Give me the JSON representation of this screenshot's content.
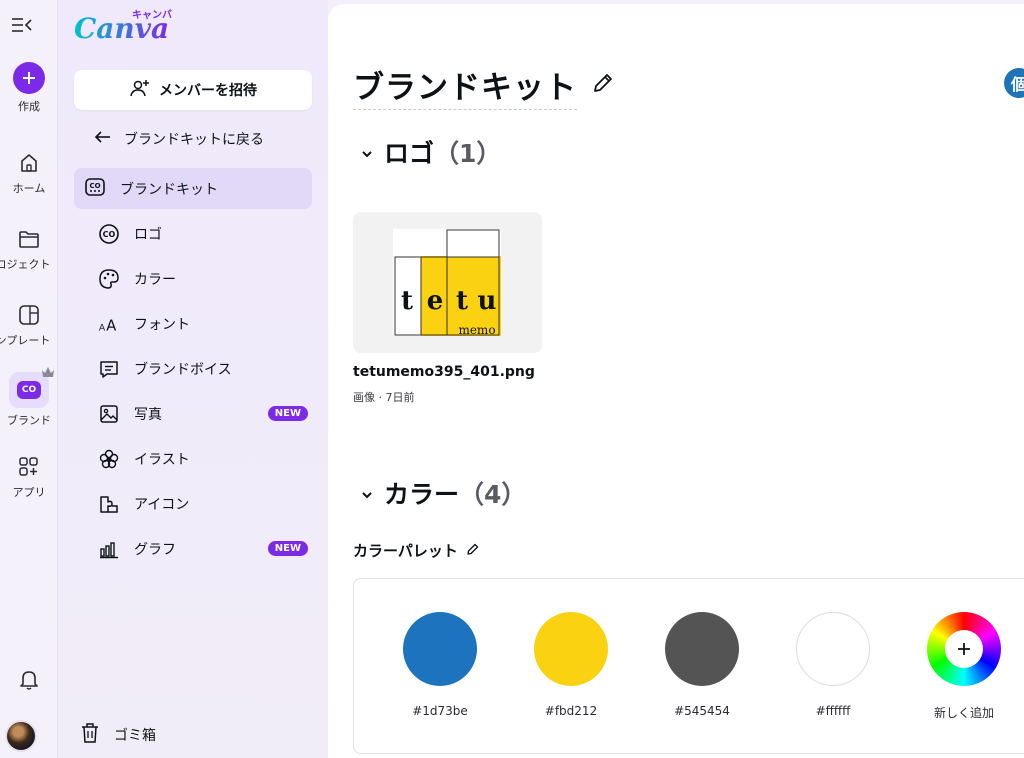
{
  "rail": {
    "create": "作成",
    "home": "ホーム",
    "projects": "ロジェクト",
    "templates": "ンプレート",
    "brand": "ブランド",
    "brand_chip": "CO",
    "apps": "アプリ"
  },
  "panel": {
    "logo_main": "Canva",
    "logo_sub": "キャンバ",
    "invite": "メンバーを招待",
    "back": "ブランドキットに戻る",
    "brand_kit": "ブランドキット",
    "items": [
      {
        "label": "ロゴ",
        "icon": "logo-co-icon"
      },
      {
        "label": "カラー",
        "icon": "palette-icon"
      },
      {
        "label": "フォント",
        "icon": "font-icon"
      },
      {
        "label": "ブランドボイス",
        "icon": "message-icon"
      },
      {
        "label": "写真",
        "icon": "image-icon",
        "badge": "NEW"
      },
      {
        "label": "イラスト",
        "icon": "flower-icon"
      },
      {
        "label": "アイコン",
        "icon": "shapes-icon"
      },
      {
        "label": "グラフ",
        "icon": "chart-icon",
        "badge": "NEW"
      }
    ],
    "trash": "ゴミ箱"
  },
  "main": {
    "title": "ブランドキット",
    "scope_chip": "個",
    "logo_section": {
      "label": "ロゴ",
      "count": "（1）"
    },
    "logo_file": {
      "name": "tetumemo395_401.png",
      "meta": "画像 · 7日前",
      "letters": [
        "t",
        "e",
        "t",
        "u"
      ],
      "subtext": "memo"
    },
    "color_section": {
      "label": "カラー",
      "count": "（4）"
    },
    "palette_title": "カラーパレット",
    "colors": [
      "#1d73be",
      "#fbd212",
      "#545454",
      "#ffffff"
    ],
    "add_label": "新しく追加"
  },
  "colors": {
    "accent": "#7d2ae8",
    "active_bg": "#e2d8f8"
  }
}
